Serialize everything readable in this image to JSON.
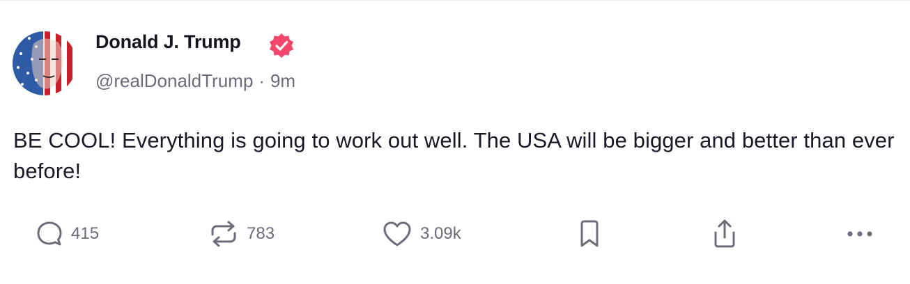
{
  "post": {
    "author": {
      "display_name": "Donald J. Trump",
      "handle": "@realDonaldTrump",
      "verified": true,
      "verified_icon": "verified-badge-icon",
      "verified_color": "#f2466a"
    },
    "separator": "·",
    "timestamp": "9m",
    "text": "BE COOL! Everything is going to work out well. The USA will be bigger and better than ever before!",
    "actions": {
      "reply": {
        "icon": "reply-icon",
        "count": "415"
      },
      "repost": {
        "icon": "repost-icon",
        "count": "783"
      },
      "like": {
        "icon": "heart-icon",
        "count": "3.09k"
      },
      "bookmark": {
        "icon": "bookmark-icon"
      },
      "share": {
        "icon": "share-icon"
      },
      "more": {
        "icon": "more-icon"
      }
    }
  },
  "colors": {
    "text": "#1a1a26",
    "muted": "#6b6b7a",
    "accent": "#f2466a"
  }
}
